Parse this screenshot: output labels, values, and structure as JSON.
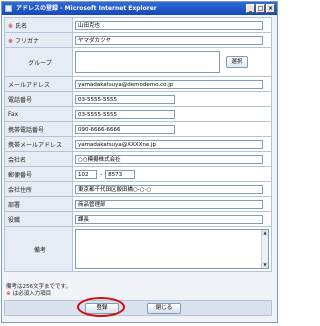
{
  "window": {
    "title": "アドレスの登録 - Microsoft Internet Explorer",
    "minimize": "_",
    "maximize": "□",
    "close": "×"
  },
  "required_mark": "※",
  "fields": {
    "name": {
      "label": "氏名",
      "value": "山田克也"
    },
    "furigana": {
      "label": "フリガナ",
      "value": "ヤマダカツヤ"
    },
    "group": {
      "label": "グループ",
      "value": "",
      "button": "選択"
    },
    "email": {
      "label": "メールアドレス",
      "value": "yamadakatsuya@demodemo.co.jp"
    },
    "phone": {
      "label": "電話番号",
      "value": "03-5555-5555"
    },
    "fax": {
      "label": "Fax",
      "value": "03-5555-5555"
    },
    "mobile": {
      "label": "携帯電話番号",
      "value": "090-6666-6666"
    },
    "mobile_email": {
      "label": "携帯メールアドレス",
      "value": "yamadakatsuya@XXXXne.jp"
    },
    "company": {
      "label": "会社名",
      "value": "○○模擬株式会社"
    },
    "postal": {
      "label": "郵便番号",
      "value1": "102",
      "separator": "-",
      "value2": "8573"
    },
    "address": {
      "label": "会社住所",
      "value": "東京都千代田区飯田橋○-○-○"
    },
    "department": {
      "label": "部署",
      "value": "商品管理部"
    },
    "title": {
      "label": "役職",
      "value": "課長"
    },
    "memo": {
      "label": "備考",
      "value": ""
    }
  },
  "notes": {
    "line1": "備考は256文字までです。",
    "line2_text": "は必須入力項目"
  },
  "buttons": {
    "register": "登録",
    "close": "閉じる"
  }
}
